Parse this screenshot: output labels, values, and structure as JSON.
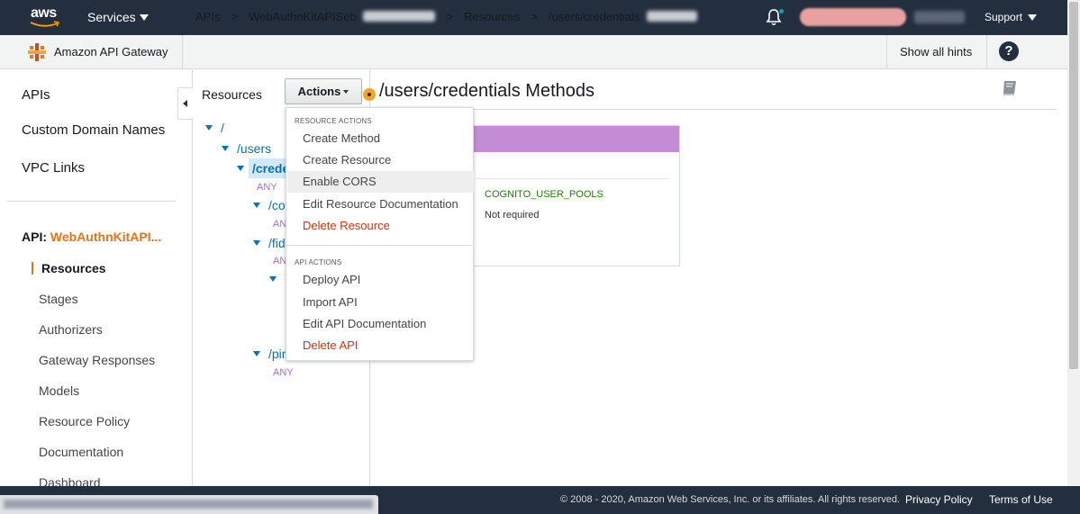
{
  "topbar": {
    "logo_text": "aws",
    "services_label": "Services",
    "support_label": "Support",
    "icons": [
      "bell-icon",
      "caret-down-icon"
    ],
    "colors": {
      "bar": "#232f3e",
      "notification": "#00a1c9"
    }
  },
  "breadcrumb": {
    "service_name": "Amazon API Gateway",
    "items": [
      "APIs",
      "WebAuthnKitAPISeb",
      "Resources",
      "/users/credentials"
    ],
    "separator": ">",
    "hints_label": "Show all hints",
    "help_icon": "?"
  },
  "sidebar": {
    "top_items": [
      "APIs",
      "Custom Domain Names",
      "VPC Links"
    ],
    "api_prefix": "API:",
    "api_name": "WebAuthnKitAPI...",
    "sub_items": [
      "Resources",
      "Stages",
      "Authorizers",
      "Gateway Responses",
      "Models",
      "Resource Policy",
      "Documentation",
      "Dashboard"
    ],
    "active_item": "Resources",
    "accent_color": "#ec7211"
  },
  "resources": {
    "title": "Resources",
    "tree": [
      {
        "label": "/",
        "kind": "node"
      },
      {
        "label": "/users",
        "kind": "node"
      },
      {
        "label": "/crede",
        "kind": "node",
        "selected": true
      },
      {
        "label": "ANY",
        "kind": "method"
      },
      {
        "label": "/co",
        "kind": "node"
      },
      {
        "label": "AN",
        "kind": "method"
      },
      {
        "label": "/fid",
        "kind": "node"
      },
      {
        "label": "AN",
        "kind": "method"
      },
      {
        "label": "/pir",
        "kind": "node"
      },
      {
        "label": "ANY",
        "kind": "method"
      }
    ]
  },
  "actions": {
    "button_label": "Actions",
    "resource_section": "RESOURCE ACTIONS",
    "resource_items": [
      {
        "label": "Create Method",
        "danger": false
      },
      {
        "label": "Create Resource",
        "danger": false
      },
      {
        "label": "Enable CORS",
        "danger": false,
        "highlighted": true
      },
      {
        "label": "Edit Resource Documentation",
        "danger": false
      },
      {
        "label": "Delete Resource",
        "danger": true
      }
    ],
    "api_section": "API ACTIONS",
    "api_items": [
      {
        "label": "Deploy API",
        "danger": false
      },
      {
        "label": "Import API",
        "danger": false
      },
      {
        "label": "Edit API Documentation",
        "danger": false
      },
      {
        "label": "Delete API",
        "danger": true
      }
    ],
    "danger_color": "#d13212"
  },
  "main": {
    "title": "/users/credentials Methods",
    "card": {
      "header_color": "#c58cd6",
      "authorization": "COGNITO_USER_POOLS",
      "api_key": "Not required"
    }
  },
  "footer": {
    "copyright": "© 2008 - 2020, Amazon Web Services, Inc. or its affiliates. All rights reserved.",
    "privacy": "Privacy Policy",
    "terms": "Terms of Use"
  }
}
